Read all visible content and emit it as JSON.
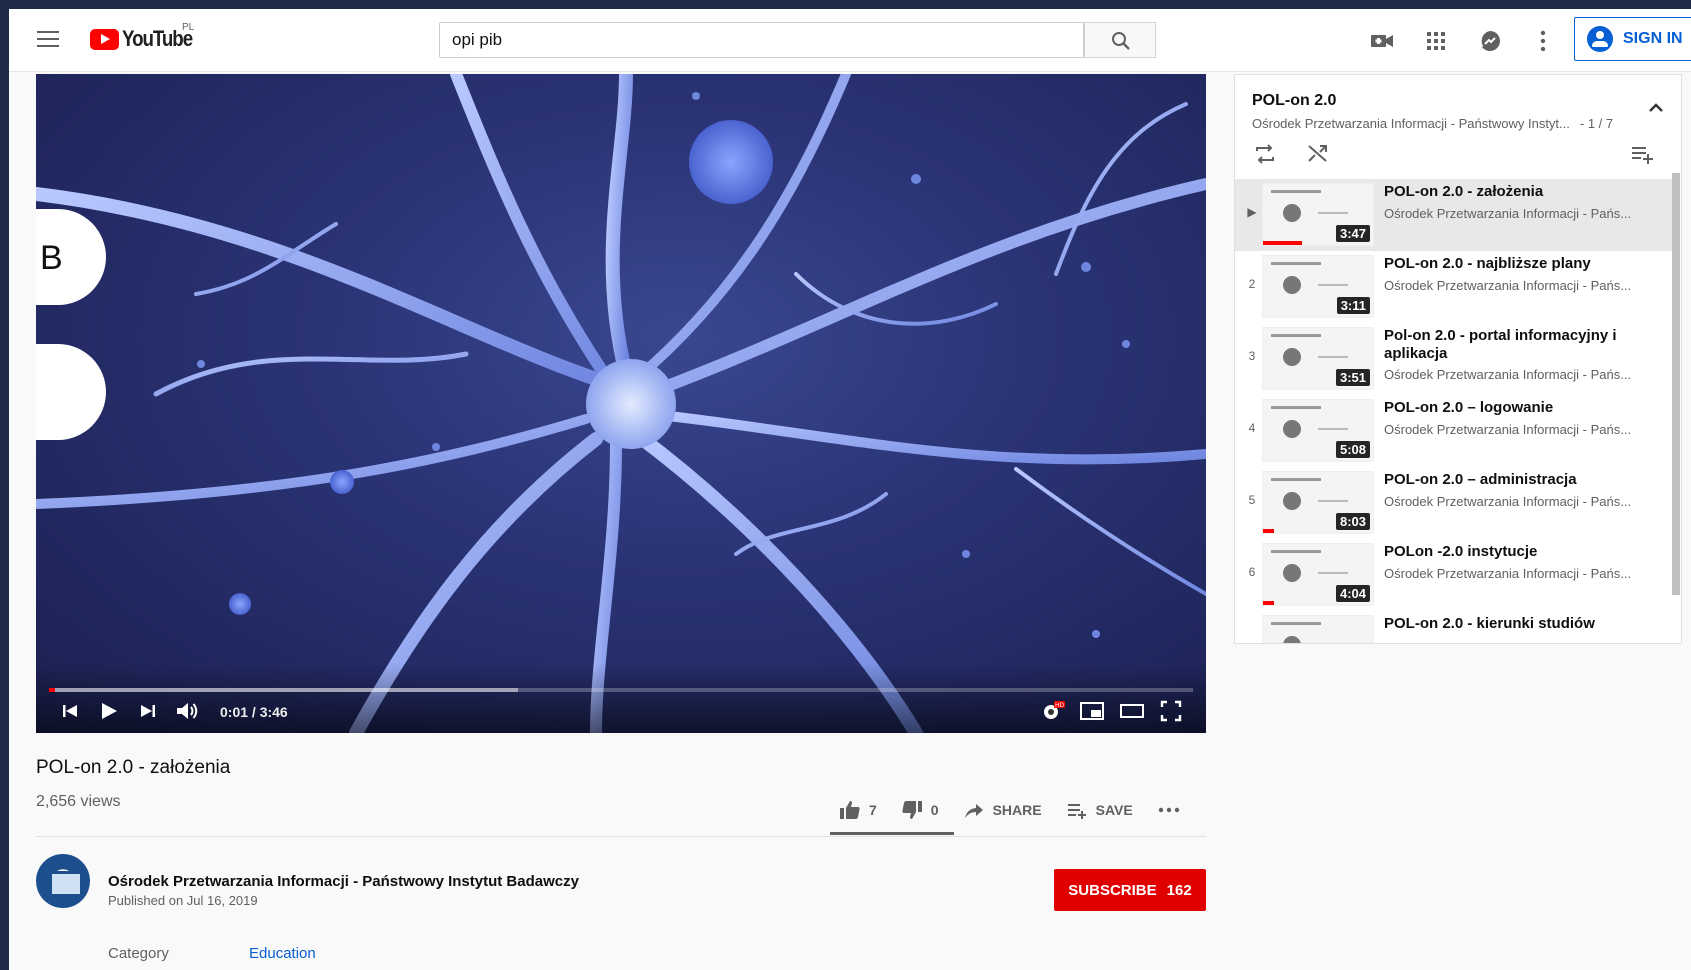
{
  "header": {
    "logo_text": "YouTube",
    "region": "PL",
    "search_value": "opi pib",
    "signin_label": "SIGN IN"
  },
  "player": {
    "time_display": "0:01 / 3:46",
    "progress_fraction": 0.005,
    "buffer_fraction": 0.41,
    "side_bubble_letter": "B"
  },
  "video": {
    "title": "POL-on 2.0 - założenia",
    "views": "2,656 views",
    "likes": "7",
    "dislikes": "0",
    "share_label": "SHARE",
    "save_label": "SAVE",
    "like_ratio": 1.0
  },
  "channel": {
    "name": "Ośrodek Przetwarzania Informacji - Państwowy Instytut Badawczy",
    "published": "Published on Jul 16, 2019",
    "subscribe_label": "SUBSCRIBE",
    "subscriber_count": "162"
  },
  "meta": {
    "category_label": "Category",
    "category_value": "Education"
  },
  "playlist": {
    "title": "POL-on 2.0",
    "owner": "Ośrodek Przetwarzania Informacji - Państwowy Instyt...",
    "position": "- 1 / 7",
    "items": [
      {
        "index": "▶",
        "title": "POL-on 2.0 - założenia",
        "channel": "Ośrodek Przetwarzania Informacji - Pańs...",
        "duration": "3:47",
        "watched": 0.35
      },
      {
        "index": "2",
        "title": "POL-on 2.0 - najbliższe plany",
        "channel": "Ośrodek Przetwarzania Informacji - Pańs...",
        "duration": "3:11",
        "watched": 0
      },
      {
        "index": "3",
        "title": "Pol-on 2.0 - portal informacyjny i aplikacja",
        "channel": "Ośrodek Przetwarzania Informacji - Pańs...",
        "duration": "3:51",
        "watched": 0
      },
      {
        "index": "4",
        "title": "POL-on 2.0 – logowanie",
        "channel": "Ośrodek Przetwarzania Informacji - Pańs...",
        "duration": "5:08",
        "watched": 0
      },
      {
        "index": "5",
        "title": "POL-on 2.0 – administracja",
        "channel": "Ośrodek Przetwarzania Informacji - Pańs...",
        "duration": "8:03",
        "watched": 0.1
      },
      {
        "index": "6",
        "title": "POLon -2.0 instytucje",
        "channel": "Ośrodek Przetwarzania Informacji - Pańs...",
        "duration": "4:04",
        "watched": 0.1
      },
      {
        "index": "",
        "title": "POL-on 2.0 - kierunki studiów",
        "channel": "",
        "duration": "",
        "watched": 0
      }
    ]
  }
}
